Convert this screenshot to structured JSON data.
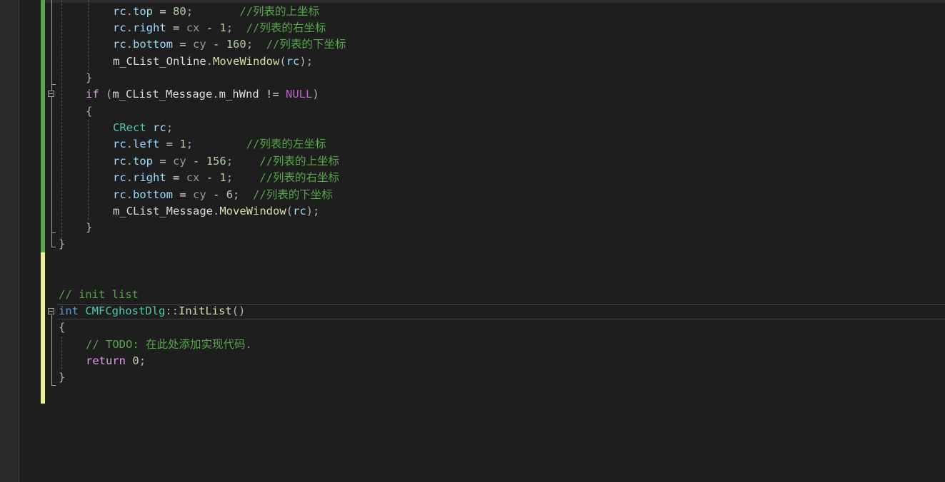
{
  "editor": {
    "language": "C++",
    "lines": [
      {
        "tokens": [
          {
            "t": "rc",
            "c": "var"
          },
          {
            "t": ".",
            "c": "punc"
          },
          {
            "t": "top",
            "c": "var"
          },
          {
            "t": " = ",
            "c": "plain"
          },
          {
            "t": "80",
            "c": "num"
          },
          {
            "t": ";",
            "c": "punc"
          },
          {
            "t": "       ",
            "c": "plain"
          },
          {
            "t": "//列表的上坐标",
            "c": "cmt"
          }
        ]
      },
      {
        "tokens": [
          {
            "t": "rc",
            "c": "var"
          },
          {
            "t": ".",
            "c": "punc"
          },
          {
            "t": "right",
            "c": "var"
          },
          {
            "t": " = ",
            "c": "plain"
          },
          {
            "t": "cx",
            "c": "param"
          },
          {
            "t": " - ",
            "c": "plain"
          },
          {
            "t": "1",
            "c": "num"
          },
          {
            "t": ";",
            "c": "punc"
          },
          {
            "t": "  ",
            "c": "plain"
          },
          {
            "t": "//列表的右坐标",
            "c": "cmt"
          }
        ]
      },
      {
        "tokens": [
          {
            "t": "rc",
            "c": "var"
          },
          {
            "t": ".",
            "c": "punc"
          },
          {
            "t": "bottom",
            "c": "var"
          },
          {
            "t": " = ",
            "c": "plain"
          },
          {
            "t": "cy",
            "c": "param"
          },
          {
            "t": " - ",
            "c": "plain"
          },
          {
            "t": "160",
            "c": "num"
          },
          {
            "t": ";",
            "c": "punc"
          },
          {
            "t": "  ",
            "c": "plain"
          },
          {
            "t": "//列表的下坐标",
            "c": "cmt"
          }
        ]
      },
      {
        "tokens": [
          {
            "t": "m_CList_Online",
            "c": "plain"
          },
          {
            "t": ".",
            "c": "punc"
          },
          {
            "t": "MoveWindow",
            "c": "fn"
          },
          {
            "t": "(",
            "c": "punc"
          },
          {
            "t": "rc",
            "c": "var"
          },
          {
            "t": ");",
            "c": "punc"
          }
        ]
      },
      {
        "tokens": [
          {
            "t": "}",
            "c": "punc"
          }
        ]
      },
      {
        "tokens": [
          {
            "t": "if",
            "c": "ctl"
          },
          {
            "t": " (",
            "c": "punc"
          },
          {
            "t": "m_CList_Message",
            "c": "plain"
          },
          {
            "t": ".",
            "c": "punc"
          },
          {
            "t": "m_hWnd",
            "c": "plain"
          },
          {
            "t": " != ",
            "c": "plain"
          },
          {
            "t": "NULL",
            "c": "mac"
          },
          {
            "t": ")",
            "c": "punc"
          }
        ]
      },
      {
        "tokens": [
          {
            "t": "{",
            "c": "punc"
          }
        ]
      },
      {
        "tokens": [
          {
            "t": "CRect",
            "c": "cls"
          },
          {
            "t": " ",
            "c": "plain"
          },
          {
            "t": "rc",
            "c": "var"
          },
          {
            "t": ";",
            "c": "punc"
          }
        ]
      },
      {
        "tokens": [
          {
            "t": "rc",
            "c": "var"
          },
          {
            "t": ".",
            "c": "punc"
          },
          {
            "t": "left",
            "c": "var"
          },
          {
            "t": " = ",
            "c": "plain"
          },
          {
            "t": "1",
            "c": "num"
          },
          {
            "t": ";",
            "c": "punc"
          },
          {
            "t": "        ",
            "c": "plain"
          },
          {
            "t": "//列表的左坐标",
            "c": "cmt"
          }
        ]
      },
      {
        "tokens": [
          {
            "t": "rc",
            "c": "var"
          },
          {
            "t": ".",
            "c": "punc"
          },
          {
            "t": "top",
            "c": "var"
          },
          {
            "t": " = ",
            "c": "plain"
          },
          {
            "t": "cy",
            "c": "param"
          },
          {
            "t": " - ",
            "c": "plain"
          },
          {
            "t": "156",
            "c": "num"
          },
          {
            "t": ";",
            "c": "punc"
          },
          {
            "t": "    ",
            "c": "plain"
          },
          {
            "t": "//列表的上坐标",
            "c": "cmt"
          }
        ]
      },
      {
        "tokens": [
          {
            "t": "rc",
            "c": "var"
          },
          {
            "t": ".",
            "c": "punc"
          },
          {
            "t": "right",
            "c": "var"
          },
          {
            "t": " = ",
            "c": "plain"
          },
          {
            "t": "cx",
            "c": "param"
          },
          {
            "t": " - ",
            "c": "plain"
          },
          {
            "t": "1",
            "c": "num"
          },
          {
            "t": ";",
            "c": "punc"
          },
          {
            "t": "    ",
            "c": "plain"
          },
          {
            "t": "//列表的右坐标",
            "c": "cmt"
          }
        ]
      },
      {
        "tokens": [
          {
            "t": "rc",
            "c": "var"
          },
          {
            "t": ".",
            "c": "punc"
          },
          {
            "t": "bottom",
            "c": "var"
          },
          {
            "t": " = ",
            "c": "plain"
          },
          {
            "t": "cy",
            "c": "param"
          },
          {
            "t": " - ",
            "c": "plain"
          },
          {
            "t": "6",
            "c": "num"
          },
          {
            "t": ";",
            "c": "punc"
          },
          {
            "t": "  ",
            "c": "plain"
          },
          {
            "t": "//列表的下坐标",
            "c": "cmt"
          }
        ]
      },
      {
        "tokens": [
          {
            "t": "m_CList_Message",
            "c": "plain"
          },
          {
            "t": ".",
            "c": "punc"
          },
          {
            "t": "MoveWindow",
            "c": "fn"
          },
          {
            "t": "(",
            "c": "punc"
          },
          {
            "t": "rc",
            "c": "var"
          },
          {
            "t": ");",
            "c": "punc"
          }
        ]
      },
      {
        "tokens": [
          {
            "t": "}",
            "c": "punc"
          }
        ]
      },
      {
        "tokens": [
          {
            "t": "}",
            "c": "punc"
          }
        ]
      },
      {
        "tokens": []
      },
      {
        "tokens": []
      },
      {
        "tokens": [
          {
            "t": "// init list",
            "c": "cmt"
          }
        ]
      },
      {
        "tokens": [
          {
            "t": "int",
            "c": "kw"
          },
          {
            "t": " ",
            "c": "plain"
          },
          {
            "t": "CMFCghostDlg",
            "c": "cls"
          },
          {
            "t": "::",
            "c": "punc"
          },
          {
            "t": "InitList",
            "c": "fn"
          },
          {
            "t": "()",
            "c": "punc"
          }
        ]
      },
      {
        "tokens": [
          {
            "t": "{",
            "c": "punc"
          }
        ]
      },
      {
        "tokens": [
          {
            "t": "// TODO: 在此处添加实现代码.",
            "c": "cmt"
          }
        ]
      },
      {
        "tokens": [
          {
            "t": "return",
            "c": "ctl"
          },
          {
            "t": " ",
            "c": "plain"
          },
          {
            "t": "0",
            "c": "num"
          },
          {
            "t": ";",
            "c": "punc"
          }
        ]
      },
      {
        "tokens": [
          {
            "t": "}",
            "c": "punc"
          }
        ]
      }
    ]
  }
}
